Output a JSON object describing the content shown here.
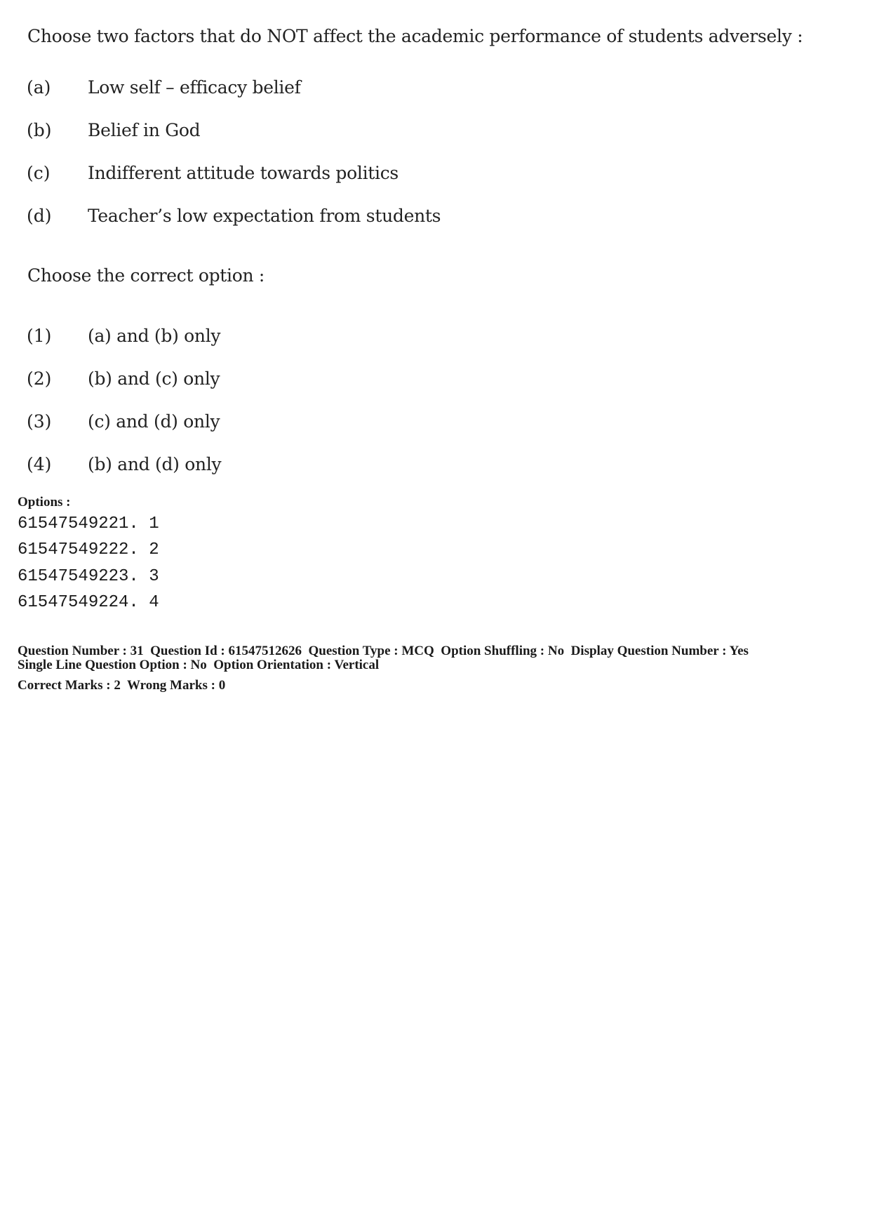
{
  "question": {
    "stem": "Choose two factors that do NOT affect the academic performance of students adversely :",
    "statements": [
      {
        "label": "(a)",
        "text": "Low self – efficacy belief"
      },
      {
        "label": "(b)",
        "text": "Belief in God"
      },
      {
        "label": "(c)",
        "text": "Indifferent attitude towards politics"
      },
      {
        "label": "(d)",
        "text": "Teacher’s low expectation from students"
      }
    ],
    "prompt": "Choose the correct option :",
    "choices": [
      {
        "label": "(1)",
        "text": "(a) and (b) only"
      },
      {
        "label": "(2)",
        "text": "(b) and (c) only"
      },
      {
        "label": "(3)",
        "text": "(c) and (d) only"
      },
      {
        "label": "(4)",
        "text": "(b) and (d) only"
      }
    ]
  },
  "options": {
    "title": "Options :",
    "items": [
      "61547549221. 1",
      "61547549222. 2",
      "61547549223. 3",
      "61547549224. 4"
    ]
  },
  "meta": {
    "line1": "Question Number : 31  Question Id : 61547512626  Question Type : MCQ  Option Shuffling : No  Display Question Number : Yes",
    "line2": "Single Line Question Option : No  Option Orientation : Vertical",
    "line3": "Correct Marks : 2  Wrong Marks : 0"
  }
}
